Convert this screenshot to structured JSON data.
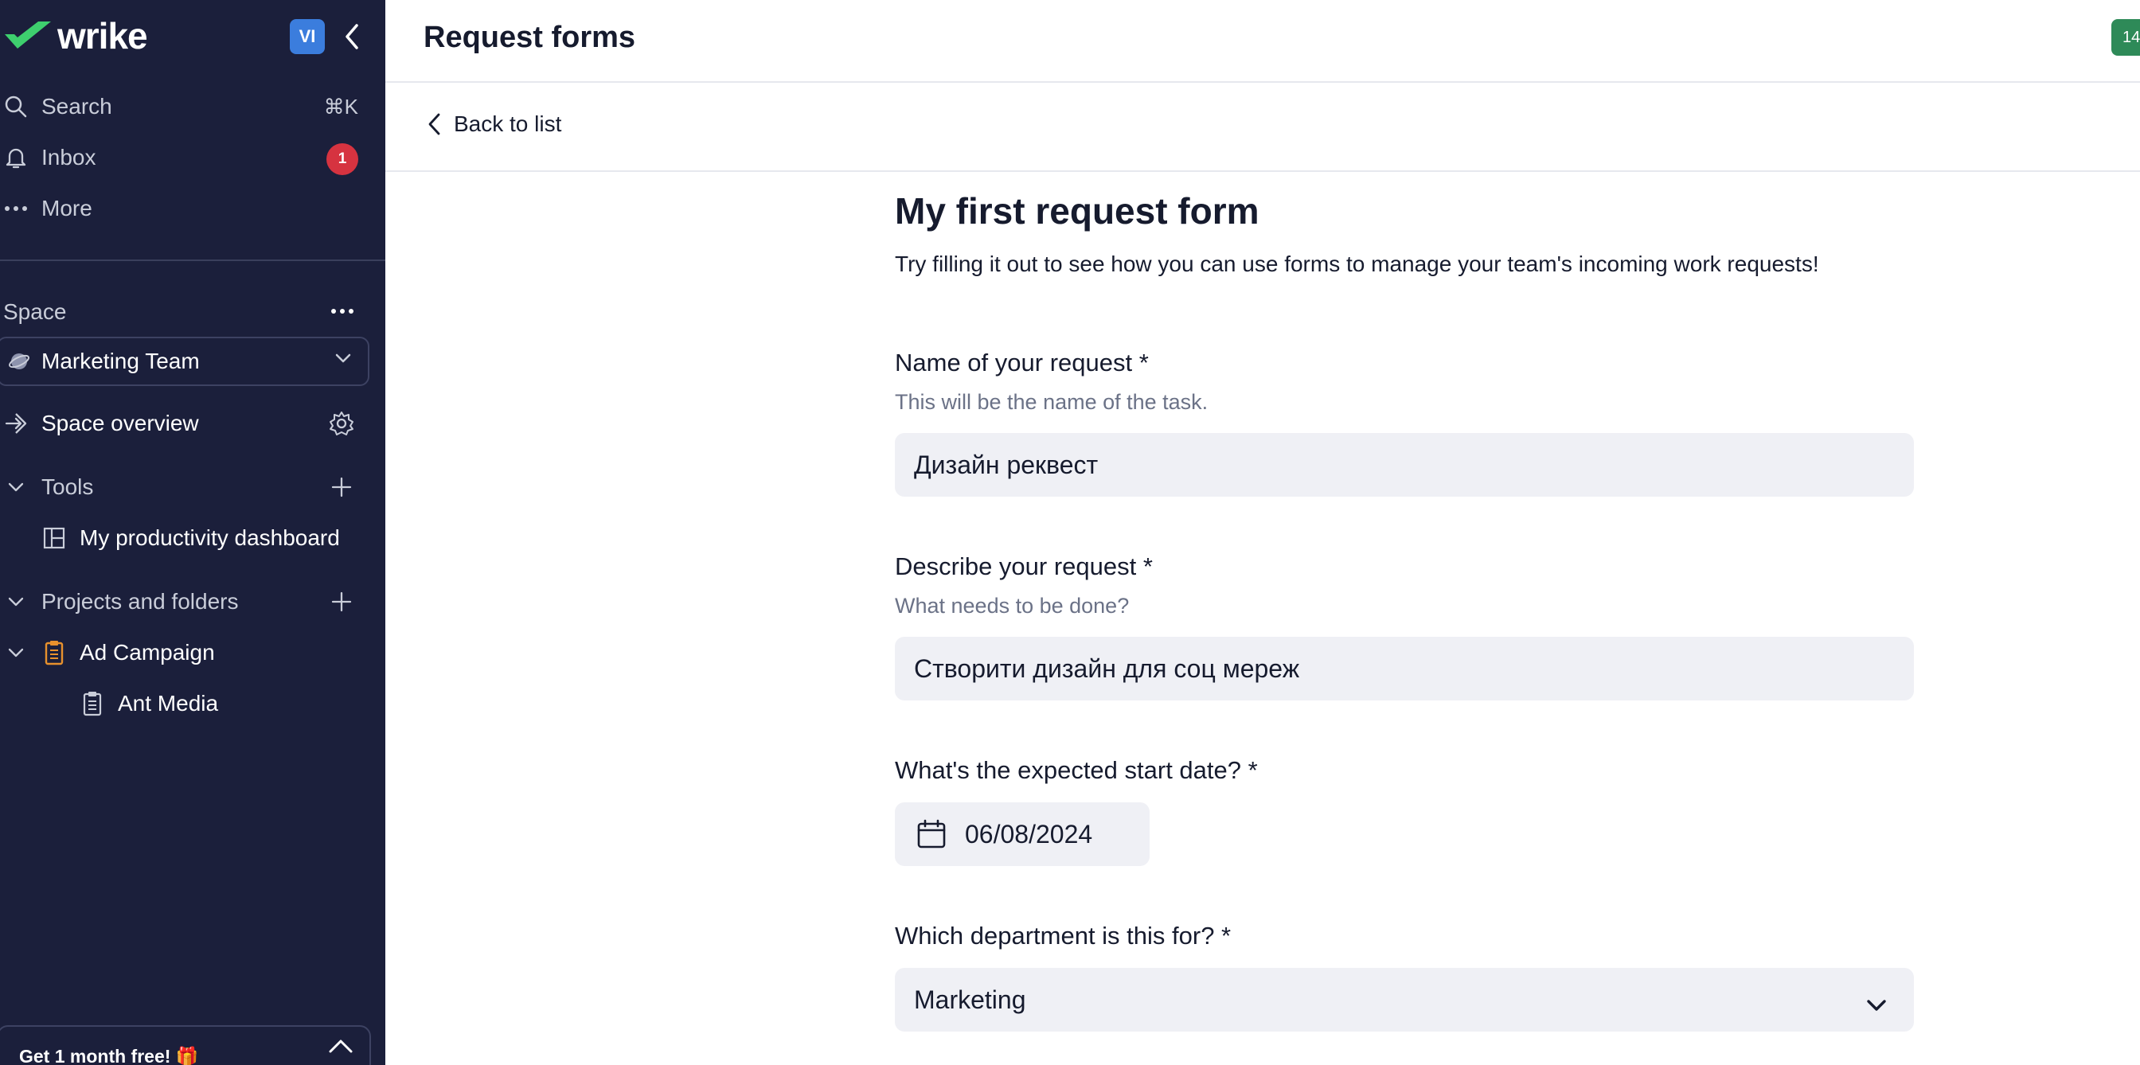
{
  "sidebar": {
    "logo_text": "wrike",
    "avatar_initials": "VI",
    "nav": {
      "search_label": "Search",
      "search_shortcut": "⌘K",
      "inbox_label": "Inbox",
      "inbox_count": "1",
      "more_label": "More"
    },
    "space_label": "Space",
    "space_selected": "Marketing Team",
    "space_overview_label": "Space overview",
    "tools_label": "Tools",
    "tools_items": [
      {
        "label": "My productivity dashboard",
        "icon": "dashboard-icon"
      }
    ],
    "projects_label": "Projects and folders",
    "projects": [
      {
        "label": "Ad Campaign",
        "icon": "project-icon"
      },
      {
        "label": "Ant Media",
        "icon": "project-icon"
      }
    ],
    "promo_text": "Get 1 month free! 🎁"
  },
  "header": {
    "title": "Request forms",
    "pill_text": "14"
  },
  "back_label": "Back to list",
  "form": {
    "title": "My first request form",
    "description": "Try filling it out to see how you can use forms to manage your team's incoming work requests!",
    "fields": [
      {
        "label": "Name of your request *",
        "hint": "This will be the name of the task.",
        "value": "Дизайн реквест"
      },
      {
        "label": "Describe your request *",
        "hint": "What needs to be done?",
        "value": "Створити дизайн для соц мереж"
      },
      {
        "label": "What's the expected start date? *",
        "value": "06/08/2024"
      },
      {
        "label": "Which department is this for? *",
        "value": "Marketing"
      }
    ]
  },
  "colors": {
    "sidebar_bg": "#1b1f3b",
    "accent_green": "#2e8a58",
    "badge_red": "#d63340",
    "avatar_blue": "#3b7ddd",
    "project_orange": "#e8912d"
  }
}
